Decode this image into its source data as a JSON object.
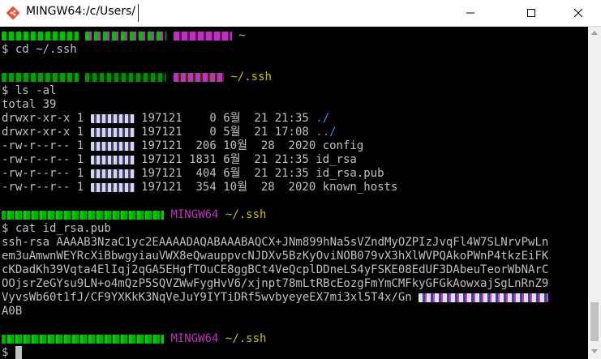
{
  "window": {
    "title": "MINGW64:/c/Users/",
    "controls": {
      "minimize_icon": "minimize-icon",
      "maximize_icon": "maximize-icon",
      "close_icon": "close-icon"
    }
  },
  "terminal": {
    "colors": {
      "background": "#000000",
      "text": "#c0c0c0",
      "user": "#00c000",
      "host": "#c030c0",
      "path": "#c8c000",
      "dir": "#3a8ef0"
    },
    "blocks": [
      {
        "prompt_path": "~",
        "command": "$ cd ~/.ssh"
      },
      {
        "prompt_path": "~/.ssh",
        "command": "$ ls -al"
      },
      {
        "prompt_host": "MINGW64",
        "prompt_path": "~/.ssh",
        "command": "$ cat id_rsa.pub"
      },
      {
        "prompt_host": "MINGW64",
        "prompt_path": "~/.ssh",
        "command": "$"
      }
    ],
    "ls_output": {
      "total": "total 39",
      "rows": [
        {
          "perm": "drwxr-xr-x",
          "links": "1",
          "group": "197121",
          "size": "0",
          "month": "6월",
          "day": "21",
          "time": "21:35",
          "name": "./",
          "is_dir": true
        },
        {
          "perm": "drwxr-xr-x",
          "links": "1",
          "group": "197121",
          "size": "0",
          "month": "5월",
          "day": "21",
          "time": "17:08",
          "name": "../",
          "is_dir": true
        },
        {
          "perm": "-rw-r--r--",
          "links": "1",
          "group": "197121",
          "size": "206",
          "month": "10월",
          "day": "28",
          "time": "2020",
          "name": "config",
          "is_dir": false
        },
        {
          "perm": "-rw-r--r--",
          "links": "1",
          "group": "197121",
          "size": "1831",
          "month": "6월",
          "day": "21",
          "time": "21:35",
          "name": "id_rsa",
          "is_dir": false
        },
        {
          "perm": "-rw-r--r--",
          "links": "1",
          "group": "197121",
          "size": "404",
          "month": "6월",
          "day": "21",
          "time": "21:35",
          "name": "id_rsa.pub",
          "is_dir": false
        },
        {
          "perm": "-rw-r--r--",
          "links": "1",
          "group": "197121",
          "size": "354",
          "month": "10월",
          "day": "28",
          "time": "2020",
          "name": "known_hosts",
          "is_dir": false
        }
      ]
    },
    "pubkey_lines": [
      "ssh-rsa AAAAB3NzaC1yc2EAAAADAQABAAABAQCX+JNm899hNa5sVZndMyOZPIzJvqFl4W7SLNrvPwLn",
      "em3uAmwnWEYRcXiBbwgyiauVWX8eQwauppvcNJDXv5BzKyOviNOB079vX3hXlWVPQAkoPWnP4tkzEiFK",
      "cKDadKh39Vqta4ElIqj2qGA5EHgfTOuCE8ggBCt4VeQcplDDneLS4yFSKE08EdUF3DAbeuTeorWbNArC",
      "OOjsrZeGYsu9LN+o4mQzP5SQVZWwFygHvV6/xjnpt78mLtRBcEozgFmYmCMFkyGFGkAowxajSgLnRnZ9",
      "VyvsWb60t1fJ/CF9YXKkK3NqVeJuY9IYTiDRf5wvbyeyeEX7mi3xl5T4x/Gn ",
      "A0B"
    ]
  }
}
